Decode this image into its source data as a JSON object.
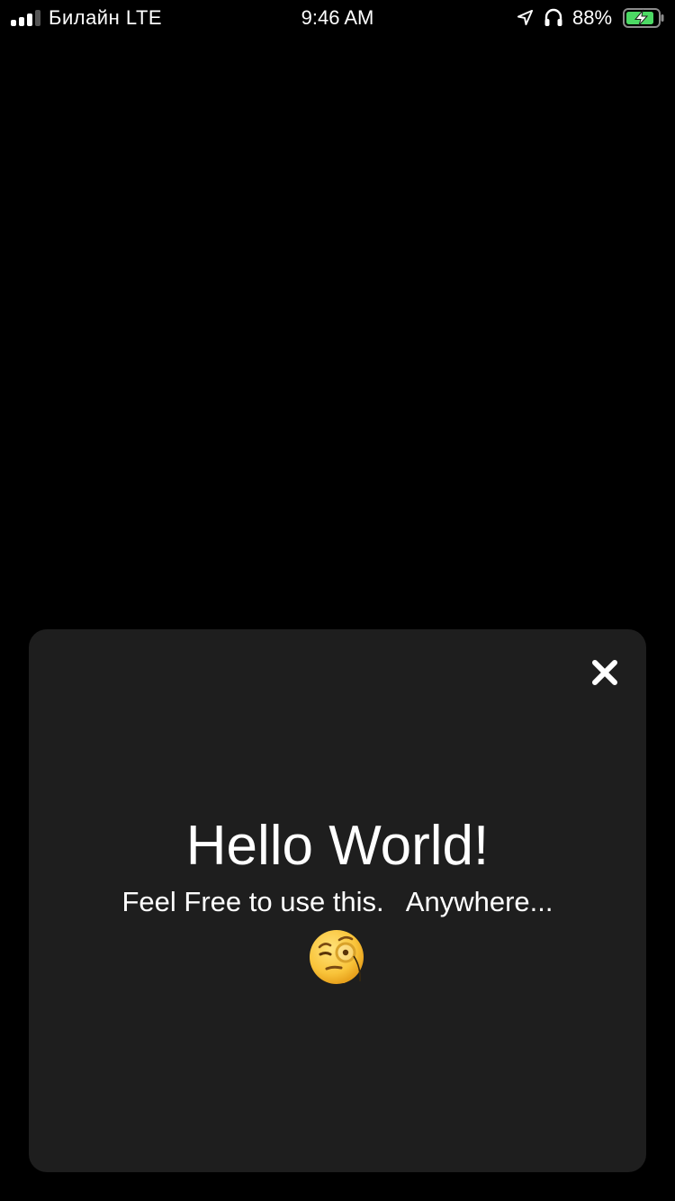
{
  "status_bar": {
    "carrier": "Билайн LTE",
    "time": "9:46 AM",
    "battery_percent": "88%",
    "battery_level": 0.88,
    "icons": [
      "signal-icon",
      "location-arrow-icon",
      "headphones-icon",
      "battery-charging-icon"
    ],
    "battery_color": "#4cd964"
  },
  "card": {
    "headline": "Hello World!",
    "subtext": "Feel Free to use this.   Anywhere...",
    "emoji": "face-with-monocle",
    "close_icon": "close-icon",
    "background_color": "#1e1e1e"
  },
  "page": {
    "background_color": "#000000"
  }
}
